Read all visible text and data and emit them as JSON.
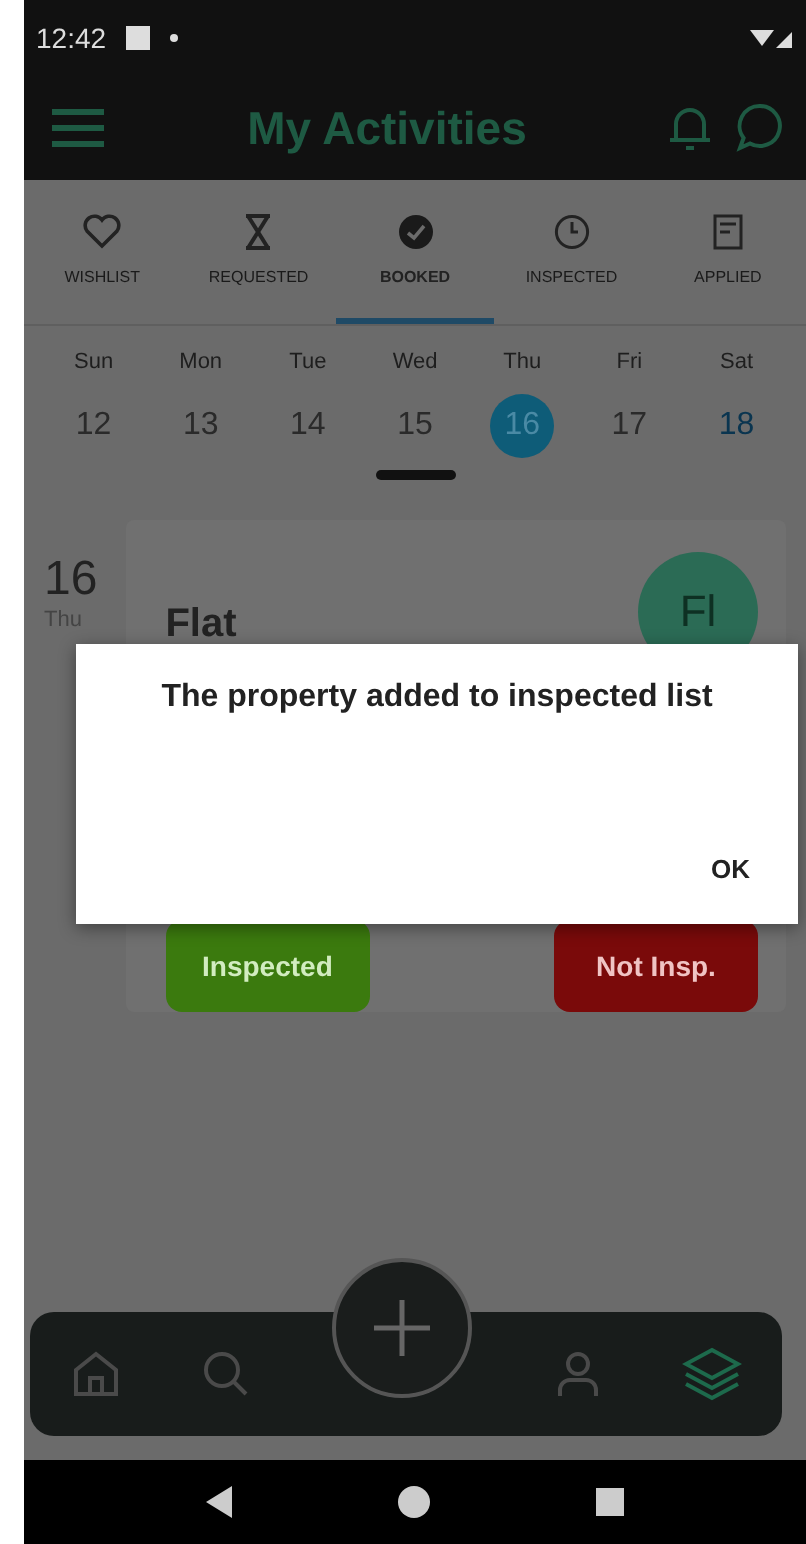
{
  "status_bar": {
    "time": "12:42"
  },
  "header": {
    "title": "My Activities"
  },
  "tabs": [
    {
      "label": "WISHLIST",
      "kind": "heart",
      "selected": false
    },
    {
      "label": "REQUESTED",
      "kind": "hourglass",
      "selected": false
    },
    {
      "label": "BOOKED",
      "kind": "check",
      "selected": true
    },
    {
      "label": "INSPECTED",
      "kind": "clock",
      "selected": false
    },
    {
      "label": "APPLIED",
      "kind": "document",
      "selected": false
    }
  ],
  "calendar": {
    "days": [
      {
        "weekday": "Sun",
        "date": "12",
        "selected": false,
        "accent": false
      },
      {
        "weekday": "Mon",
        "date": "13",
        "selected": false,
        "accent": false
      },
      {
        "weekday": "Tue",
        "date": "14",
        "selected": false,
        "accent": false
      },
      {
        "weekday": "Wed",
        "date": "15",
        "selected": false,
        "accent": false
      },
      {
        "weekday": "Thu",
        "date": "16",
        "selected": true,
        "accent": false
      },
      {
        "weekday": "Fri",
        "date": "17",
        "selected": false,
        "accent": false
      },
      {
        "weekday": "Sat",
        "date": "18",
        "selected": false,
        "accent": true
      }
    ]
  },
  "booking": {
    "day": "16",
    "weekday": "Thu",
    "title": "Flat",
    "avatar": "Fl",
    "actions": [
      {
        "label": "Inspected",
        "kind": "inspected"
      },
      {
        "label": "Not Insp.",
        "kind": "not-inspected"
      }
    ]
  },
  "dialog": {
    "message": "The property added to inspected list",
    "button": "OK"
  },
  "bottom_nav": {
    "items": [
      {
        "kind": "home",
        "selected": false
      },
      {
        "kind": "search",
        "selected": false
      },
      {
        "kind": "add",
        "selected": false
      },
      {
        "kind": "profile",
        "selected": false
      },
      {
        "kind": "layers",
        "selected": true
      }
    ]
  }
}
